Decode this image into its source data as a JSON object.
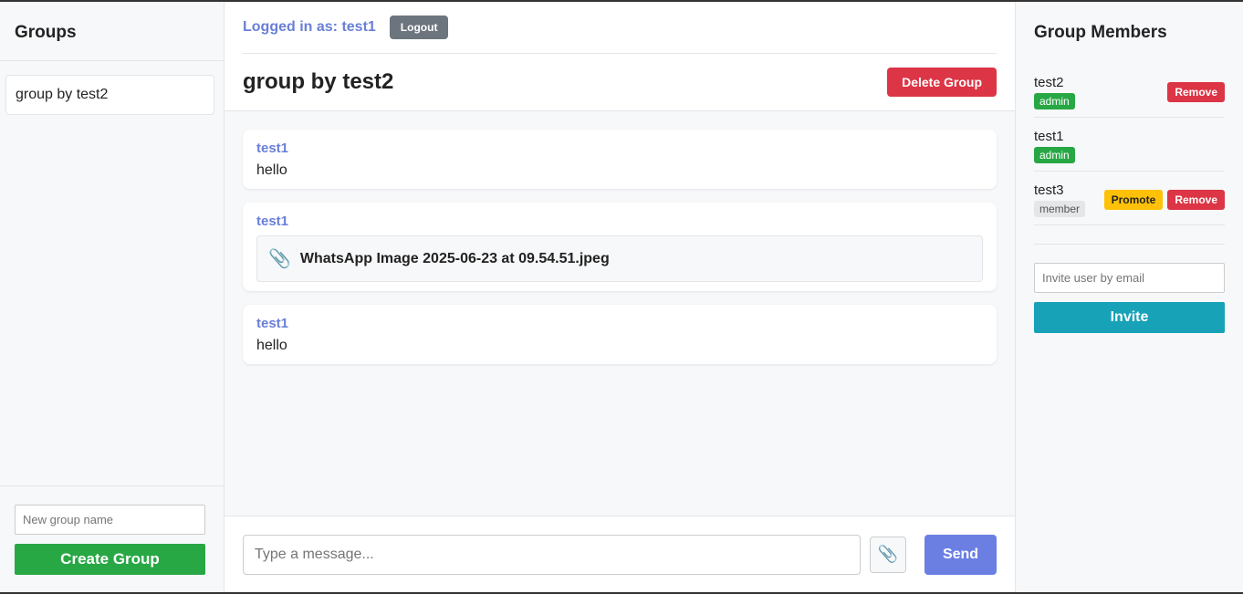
{
  "sidebar": {
    "title": "Groups",
    "groups": [
      {
        "name": "group by test2"
      }
    ],
    "new_group_placeholder": "New group name",
    "create_label": "Create Group"
  },
  "header": {
    "logged_in": "Logged in as: test1",
    "logout_label": "Logout",
    "group_title": "group by test2",
    "delete_label": "Delete Group"
  },
  "messages": [
    {
      "author": "test1",
      "text": "hello"
    },
    {
      "author": "test1",
      "attachment": "WhatsApp Image 2025-06-23 at 09.54.51.jpeg"
    },
    {
      "author": "test1",
      "text": "hello"
    }
  ],
  "composer": {
    "placeholder": "Type a message...",
    "attach_icon": "paperclip-icon",
    "send_label": "Send"
  },
  "members_panel": {
    "title": "Group Members",
    "members": [
      {
        "name": "test2",
        "role": "admin",
        "actions": [
          "Remove"
        ]
      },
      {
        "name": "test1",
        "role": "admin",
        "actions": []
      },
      {
        "name": "test3",
        "role": "member",
        "actions": [
          "Promote",
          "Remove"
        ]
      }
    ],
    "invite_placeholder": "Invite user by email",
    "invite_label": "Invite"
  },
  "colors": {
    "primary": "#6b7fe3",
    "success": "#28a745",
    "danger": "#dc3545",
    "warning": "#ffc107",
    "info": "#17a2b8",
    "secondary": "#6c757d"
  }
}
